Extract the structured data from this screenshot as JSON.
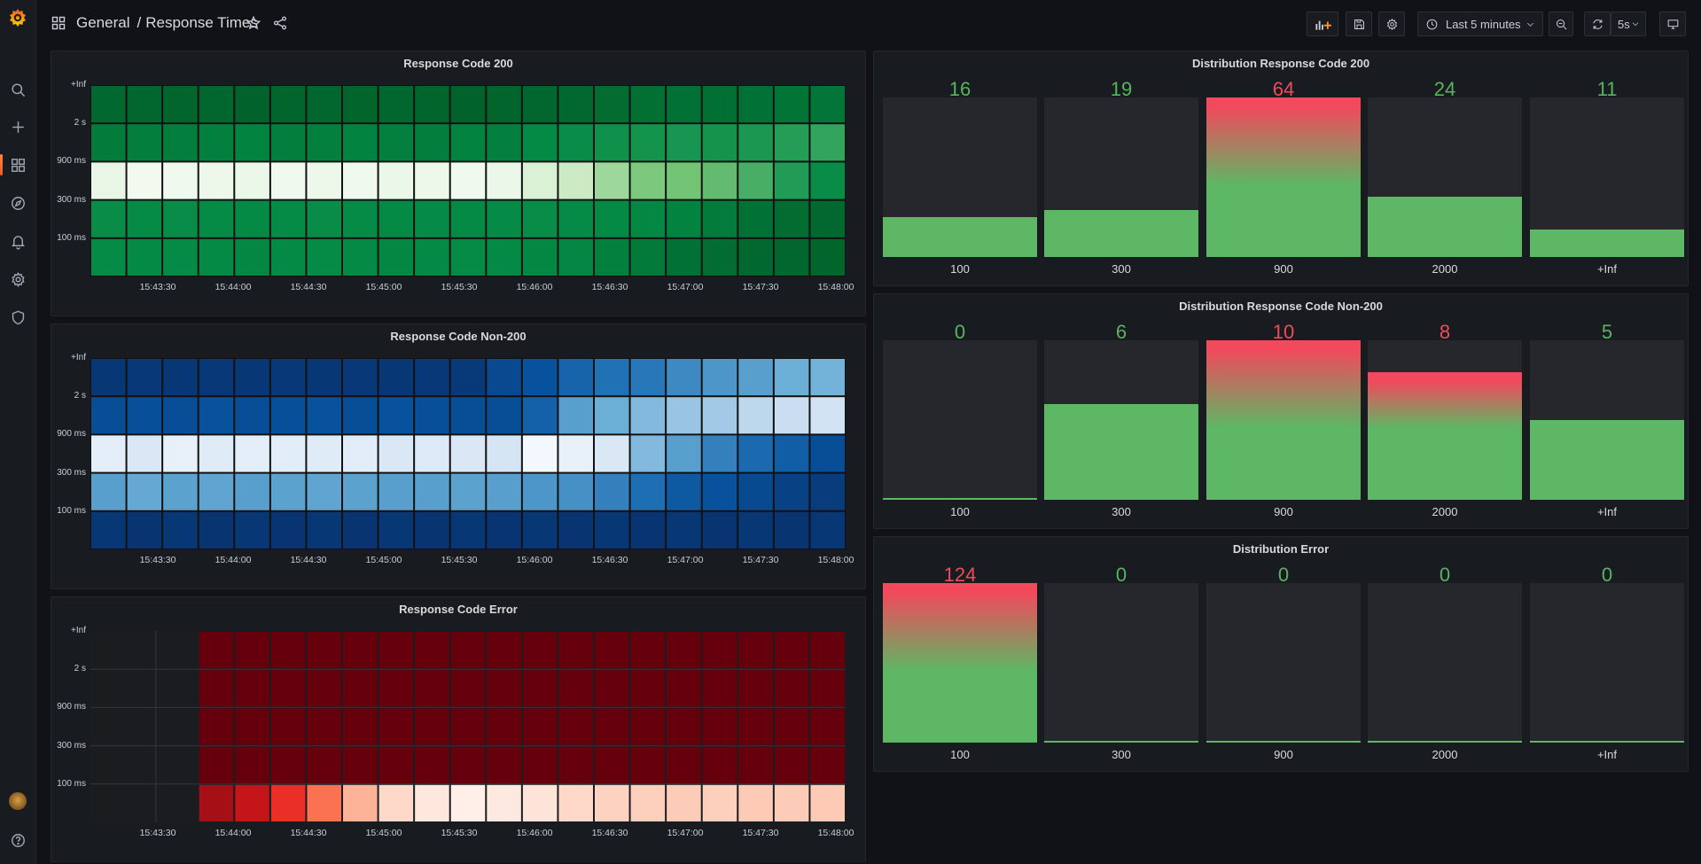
{
  "breadcrumb": {
    "folder": "General",
    "separator": "/",
    "dashboard": "Response Times"
  },
  "toolbar": {
    "time_range": "Last 5 minutes",
    "refresh_interval": "5s"
  },
  "colors": {
    "bar_ok": "#5eb764",
    "bar_alert": "#f2495c",
    "value_ok": "#5ab35f",
    "value_alert": "#f2495c"
  },
  "time_labels": [
    "15:43:30",
    "15:44:00",
    "15:44:30",
    "15:45:00",
    "15:45:30",
    "15:46:00",
    "15:46:30",
    "15:47:00",
    "15:47:30",
    "15:48:00"
  ],
  "y_buckets": [
    "+Inf",
    "2 s",
    "900 ms",
    "300 ms",
    "100 ms"
  ],
  "heatmaps": [
    {
      "title": "Response Code 200",
      "palette": "greens",
      "chart_data": {
        "type": "heatmap",
        "y_buckets": [
          "+Inf",
          "2 s",
          "900 ms",
          "300 ms",
          "100 ms"
        ],
        "x_labels": [
          "15:43:30",
          "15:44:00",
          "15:44:30",
          "15:45:00",
          "15:45:30",
          "15:46:00",
          "15:46:30",
          "15:47:00",
          "15:47:30",
          "15:48:00"
        ],
        "rows": [
          [
            0.93,
            0.94,
            0.95,
            0.94,
            0.96,
            0.95,
            0.94,
            0.95,
            0.94,
            0.95,
            0.96,
            0.95,
            0.94,
            0.93,
            0.92,
            0.91,
            0.9,
            0.91,
            0.9,
            0.89,
            0.88
          ],
          [
            0.86,
            0.85,
            0.85,
            0.84,
            0.83,
            0.85,
            0.84,
            0.83,
            0.84,
            0.85,
            0.83,
            0.84,
            0.8,
            0.78,
            0.74,
            0.72,
            0.7,
            0.72,
            0.68,
            0.63,
            0.58
          ],
          [
            0.06,
            0.02,
            0.03,
            0.04,
            0.05,
            0.03,
            0.04,
            0.03,
            0.05,
            0.04,
            0.03,
            0.05,
            0.12,
            0.18,
            0.3,
            0.38,
            0.4,
            0.45,
            0.52,
            0.65,
            0.78
          ],
          [
            0.78,
            0.79,
            0.78,
            0.79,
            0.8,
            0.79,
            0.78,
            0.79,
            0.8,
            0.79,
            0.8,
            0.79,
            0.78,
            0.79,
            0.8,
            0.81,
            0.83,
            0.86,
            0.9,
            0.92,
            0.93
          ],
          [
            0.79,
            0.8,
            0.79,
            0.8,
            0.81,
            0.8,
            0.79,
            0.8,
            0.81,
            0.8,
            0.79,
            0.8,
            0.81,
            0.82,
            0.84,
            0.87,
            0.9,
            0.92,
            0.93,
            0.94,
            0.95
          ]
        ]
      }
    },
    {
      "title": "Response Code Non-200",
      "palette": "blues",
      "chart_data": {
        "type": "heatmap",
        "y_buckets": [
          "+Inf",
          "2 s",
          "900 ms",
          "300 ms",
          "100 ms"
        ],
        "x_labels": [
          "15:43:30",
          "15:44:00",
          "15:44:30",
          "15:45:00",
          "15:45:30",
          "15:46:00",
          "15:46:30",
          "15:47:00",
          "15:47:30",
          "15:48:00"
        ],
        "rows": [
          [
            0.96,
            0.95,
            0.96,
            0.95,
            0.96,
            0.95,
            0.96,
            0.95,
            0.96,
            0.95,
            0.94,
            0.85,
            0.8,
            0.68,
            0.6,
            0.58,
            0.52,
            0.48,
            0.45,
            0.4,
            0.38
          ],
          [
            0.82,
            0.81,
            0.82,
            0.8,
            0.82,
            0.81,
            0.8,
            0.82,
            0.8,
            0.81,
            0.82,
            0.82,
            0.7,
            0.45,
            0.4,
            0.35,
            0.3,
            0.28,
            0.22,
            0.18,
            0.15
          ],
          [
            0.08,
            0.12,
            0.06,
            0.1,
            0.08,
            0.09,
            0.1,
            0.09,
            0.12,
            0.11,
            0.12,
            0.14,
            0.02,
            0.06,
            0.12,
            0.35,
            0.45,
            0.55,
            0.65,
            0.72,
            0.82
          ],
          [
            0.45,
            0.42,
            0.44,
            0.43,
            0.45,
            0.44,
            0.43,
            0.44,
            0.45,
            0.45,
            0.44,
            0.45,
            0.48,
            0.5,
            0.55,
            0.62,
            0.75,
            0.8,
            0.85,
            0.9,
            0.93
          ],
          [
            0.96,
            0.97,
            0.96,
            0.97,
            0.96,
            0.97,
            0.96,
            0.97,
            0.96,
            0.97,
            0.96,
            0.97,
            0.96,
            0.97,
            0.96,
            0.97,
            0.96,
            0.97,
            0.96,
            0.97,
            0.96
          ]
        ]
      }
    },
    {
      "title": "Response Code Error",
      "palette": "reds",
      "empty_cols": 3,
      "chart_data": {
        "type": "heatmap",
        "y_buckets": [
          "+Inf",
          "2 s",
          "900 ms",
          "300 ms",
          "100 ms"
        ],
        "x_labels": [
          "15:43:30",
          "15:44:00",
          "15:44:30",
          "15:45:00",
          "15:45:30",
          "15:46:00",
          "15:46:30",
          "15:47:00",
          "15:47:30",
          "15:48:00"
        ],
        "rows": [
          [
            null,
            null,
            null,
            1,
            1,
            1,
            1,
            1,
            1,
            1,
            1,
            1,
            1,
            1,
            1,
            1,
            1,
            1,
            1,
            1,
            1
          ],
          [
            null,
            null,
            null,
            1,
            1,
            1,
            1,
            1,
            1,
            1,
            1,
            1,
            1,
            1,
            1,
            1,
            1,
            1,
            1,
            1,
            1
          ],
          [
            null,
            null,
            null,
            1,
            1,
            1,
            1,
            1,
            1,
            1,
            1,
            1,
            1,
            1,
            1,
            1,
            1,
            1,
            1,
            1,
            1
          ],
          [
            null,
            null,
            null,
            1,
            1,
            1,
            1,
            1,
            1,
            1,
            1,
            1,
            1,
            1,
            1,
            1,
            1,
            1,
            1,
            1,
            1
          ],
          [
            null,
            null,
            null,
            0.8,
            0.7,
            0.55,
            0.38,
            0.22,
            0.1,
            0.05,
            0.02,
            0.04,
            0.06,
            0.1,
            0.12,
            0.13,
            0.14,
            0.13,
            0.15,
            0.14,
            0.15
          ]
        ]
      }
    }
  ],
  "bar_panels": [
    {
      "title": "Distribution Response Code 200",
      "chart_data": {
        "type": "bar",
        "categories": [
          "100",
          "300",
          "900",
          "2000",
          "+Inf"
        ],
        "values": [
          16,
          19,
          64,
          24,
          11
        ],
        "ylim": [
          0,
          64
        ]
      }
    },
    {
      "title": "Distribution Response Code Non-200",
      "chart_data": {
        "type": "bar",
        "categories": [
          "100",
          "300",
          "900",
          "2000",
          "+Inf"
        ],
        "values": [
          0,
          6,
          10,
          8,
          5
        ],
        "ylim": [
          0,
          10
        ]
      }
    },
    {
      "title": "Distribution Error",
      "chart_data": {
        "type": "bar",
        "categories": [
          "100",
          "300",
          "900",
          "2000",
          "+Inf"
        ],
        "values": [
          124,
          0,
          0,
          0,
          0
        ],
        "ylim": [
          0,
          124
        ]
      }
    }
  ]
}
